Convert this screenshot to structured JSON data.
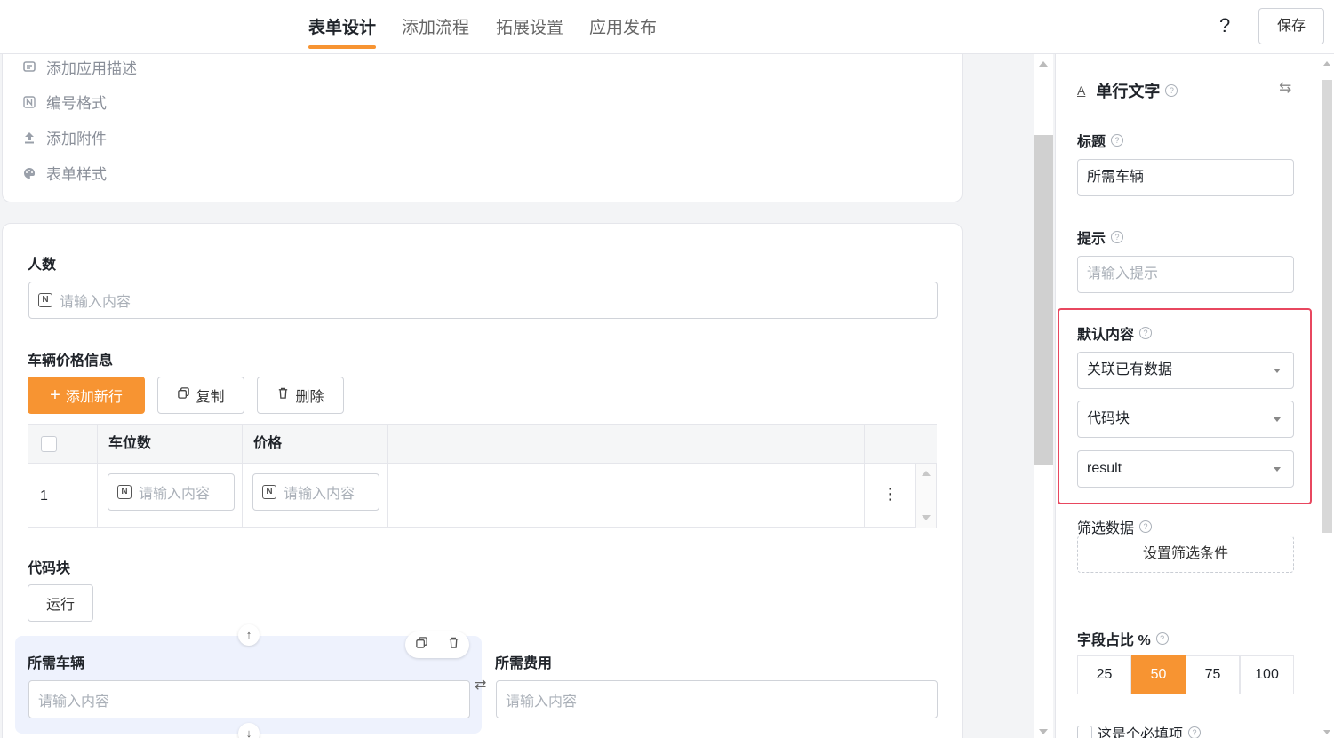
{
  "header": {
    "tabs": [
      "表单设计",
      "添加流程",
      "拓展设置",
      "应用发布"
    ],
    "active_tab": 0,
    "help_label": "?",
    "save_label": "保存"
  },
  "settings_card": {
    "items": [
      {
        "label": "添加应用描述",
        "icon": "comment-icon"
      },
      {
        "label": "编号格式",
        "icon": "number-format-icon"
      },
      {
        "label": "添加附件",
        "icon": "upload-icon"
      },
      {
        "label": "表单样式",
        "icon": "palette-icon"
      }
    ]
  },
  "form": {
    "people": {
      "label": "人数",
      "placeholder": "请输入内容",
      "icon_letter": "N"
    },
    "vehicle_table": {
      "label": "车辆价格信息",
      "add_label": "添加新行",
      "copy_label": "复制",
      "delete_label": "删除",
      "columns": [
        "车位数",
        "价格"
      ],
      "rows": [
        {
          "index": "1",
          "c1_placeholder": "请输入内容",
          "c2_placeholder": "请输入内容"
        }
      ],
      "row_menu": "⋮"
    },
    "code_block": {
      "label": "代码块",
      "run_label": "运行"
    },
    "vehicles_needed": {
      "label": "所需车辆",
      "placeholder": "请输入内容"
    },
    "cost_needed": {
      "label": "所需费用",
      "placeholder": "请输入内容"
    }
  },
  "panel": {
    "field_type": "单行文字",
    "title_label": "标题",
    "title_value": "所需车辆",
    "hint_label": "提示",
    "hint_placeholder": "请输入提示",
    "default_label": "默认内容",
    "default_source": "关联已有数据",
    "default_block": "代码块",
    "default_field": "result",
    "filter_label": "筛选数据",
    "filter_button": "设置筛选条件",
    "width_label": "字段占比 %",
    "width_options": [
      "25",
      "50",
      "75",
      "100"
    ],
    "width_selected": "50",
    "required_label": "这是个必填项"
  },
  "colors": {
    "accent": "#f79432",
    "highlight": "#e8475f",
    "selected_bg": "#eef2fd"
  }
}
